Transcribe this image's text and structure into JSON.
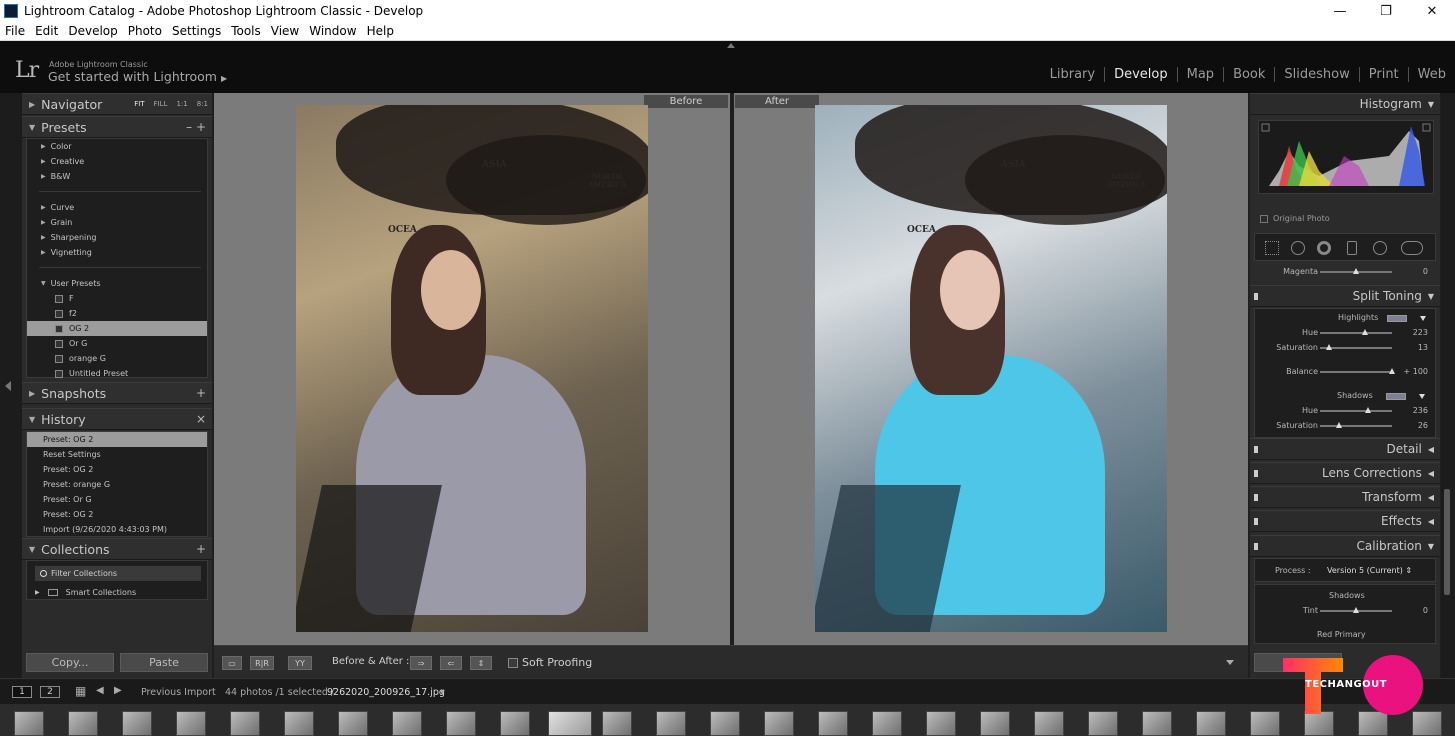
{
  "window": {
    "title": "Lightroom Catalog - Adobe Photoshop Lightroom Classic - Develop",
    "minimize": "—",
    "maximize": "❐",
    "close": "✕"
  },
  "menu": [
    "File",
    "Edit",
    "Develop",
    "Photo",
    "Settings",
    "Tools",
    "View",
    "Window",
    "Help"
  ],
  "identity": {
    "logo": "Lr",
    "product": "Adobe Lightroom Classic",
    "tagline": "Get started with Lightroom"
  },
  "modules": [
    "Library",
    "Develop",
    "Map",
    "Book",
    "Slideshow",
    "Print",
    "Web"
  ],
  "active_module": "Develop",
  "left": {
    "navigator": {
      "label": "Navigator",
      "zooms": [
        "FIT",
        "FILL",
        "1:1",
        "8:1"
      ]
    },
    "presets": {
      "label": "Presets",
      "controls": "–  +",
      "groups_a": [
        "Color",
        "Creative",
        "B&W"
      ],
      "groups_b": [
        "Curve",
        "Grain",
        "Sharpening",
        "Vignetting"
      ],
      "user_group": "User Presets",
      "user_items": [
        "F",
        "f2",
        "OG 2",
        "Or G",
        "orange G",
        "Untitled Preset"
      ],
      "selected": "OG 2"
    },
    "snapshots": {
      "label": "Snapshots",
      "control": "+"
    },
    "history": {
      "label": "History",
      "control": "×",
      "items": [
        "Preset: OG 2",
        "Reset Settings",
        "Preset: OG 2",
        "Preset: orange G",
        "Preset: Or G",
        "Preset: OG 2",
        "Import (9/26/2020 4:43:03 PM)"
      ]
    },
    "collections": {
      "label": "Collections",
      "control": "+",
      "filter": "Filter Collections",
      "smart": "Smart Collections"
    },
    "copy_button": "Copy...",
    "paste_button": "Paste"
  },
  "view": {
    "before_label": "Before",
    "after_label": "After",
    "photo_text": {
      "asia": "ASIA",
      "north": "NORTH",
      "america": "AMERICA",
      "ocean": "OCEA"
    }
  },
  "toolbar": {
    "view_mode": "YY",
    "before_after": "Before & After :",
    "soft_proofing": "Soft Proofing",
    "loupe": "▭",
    "rr": "R|R",
    "btn1": "⇒",
    "btn2": "⇐",
    "btn3": "⇕"
  },
  "right": {
    "histogram": "Histogram",
    "original_photo": "Original Photo",
    "magenta": {
      "label": "Magenta",
      "value": "0",
      "pos": 0.5
    },
    "split_toning": {
      "label": "Split Toning",
      "highlights": "Highlights",
      "hl_hue": {
        "label": "Hue",
        "value": "223",
        "pos": 0.62
      },
      "hl_sat": {
        "label": "Saturation",
        "value": "13",
        "pos": 0.13
      },
      "balance": {
        "label": "Balance",
        "value": "+ 100",
        "pos": 1.0
      },
      "shadows": "Shadows",
      "sh_hue": {
        "label": "Hue",
        "value": "236",
        "pos": 0.66
      },
      "sh_sat": {
        "label": "Saturation",
        "value": "26",
        "pos": 0.26
      }
    },
    "detail": "Detail",
    "lens": "Lens Corrections",
    "transform": "Transform",
    "effects": "Effects",
    "calibration": {
      "label": "Calibration",
      "process_label": "Process :",
      "process_value": "Version 5 (Current) ⇕",
      "shadows": "Shadows",
      "tint": {
        "label": "Tint",
        "value": "0",
        "pos": 0.5
      },
      "red_primary": "Red Primary"
    },
    "prev_button": "P"
  },
  "filmbar": {
    "num1": "1",
    "num2": "2",
    "source": "Previous Import",
    "count": "44 photos /1 selected /",
    "file": "9262020_200926_17.jpg",
    "dd": "▾"
  },
  "watermark": "TECHANGOUT",
  "colors": {
    "accent_selected": "#9c9c9c",
    "panel": "#2b2b2b",
    "center_bg": "#7b7b7b"
  }
}
